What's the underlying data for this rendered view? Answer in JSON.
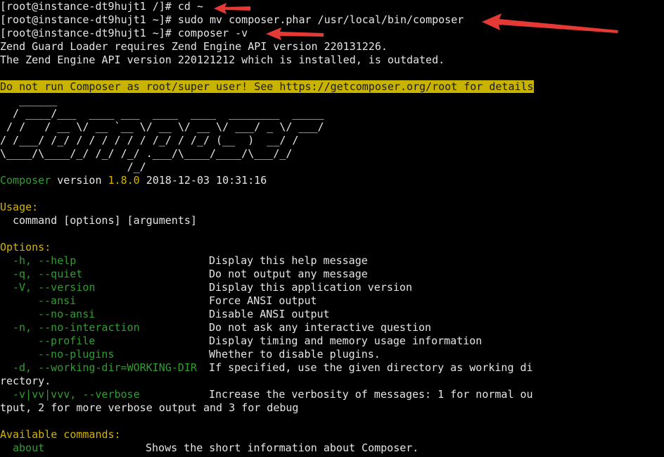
{
  "terminal": {
    "commands": [
      {
        "prompt": "[root@instance-dt9hujt1 /]# ",
        "command": "cd ~"
      },
      {
        "prompt": "[root@instance-dt9hujt1 ~]# ",
        "command": "sudo mv composer.phar /usr/local/bin/composer"
      },
      {
        "prompt": "[root@instance-dt9hujt1 ~]# ",
        "command": "composer -v"
      }
    ],
    "errors": [
      "Zend Guard Loader requires Zend Engine API version 220131226.",
      "The Zend Engine API version 220121212 which is installed, is outdated."
    ],
    "warning": "Do not run Composer as root/super user! See https://getcomposer.org/root for details",
    "logo": [
      "   ______",
      "  / ____/___  ____ ___  ____  ____  ________  _____",
      " / /   / __ \\/ __ `__ \\/ __ \\/ __ \\/ ___/ _ \\/ ___/",
      "/ /___/ /_/ / / / / / / /_/ / /_/ (__  )  __/ /",
      "\\____/\\____/_/ /_/ /_/ .___/\\____/____/\\___/_/",
      "                    /_/"
    ],
    "version": {
      "name": "Composer",
      "label": " version ",
      "number": "1.8.0",
      "date": " 2018-12-03 10:31:16"
    },
    "usage": {
      "heading": "Usage:",
      "text": "command [options] [arguments]"
    },
    "options": {
      "heading": "Options:",
      "items": [
        {
          "name": "-h, --help",
          "desc": "Display this help message",
          "long": false
        },
        {
          "name": "-q, --quiet",
          "desc": "Do not output any message",
          "long": false
        },
        {
          "name": "-V, --version",
          "desc": "Display this application version",
          "long": false
        },
        {
          "name": "--ansi",
          "desc": "Force ANSI output",
          "long": true
        },
        {
          "name": "--no-ansi",
          "desc": "Disable ANSI output",
          "long": true
        },
        {
          "name": "-n, --no-interaction",
          "desc": "Do not ask any interactive question",
          "long": false
        },
        {
          "name": "--profile",
          "desc": "Display timing and memory usage information",
          "long": true
        },
        {
          "name": "--no-plugins",
          "desc": "Whether to disable plugins.",
          "long": true
        },
        {
          "name": "-d, --working-dir=WORKING-DIR",
          "desc": "If specified, use the given directory as working di",
          "long": false,
          "wrap": "rectory."
        },
        {
          "name": "-v|vv|vvv, --verbose",
          "desc": "Increase the verbosity of messages: 1 for normal ou",
          "long": false,
          "wrap": "tput, 2 for more verbose output and 3 for debug"
        }
      ]
    },
    "available": {
      "heading": "Available commands:",
      "items": [
        {
          "name": "about",
          "desc": "Shows the short information about Composer."
        }
      ]
    },
    "colors": {
      "background": "#000000",
      "text": "#e5e5e5",
      "green": "#2f9e2f",
      "yellow": "#d6b400",
      "warning_bg": "#c8b400",
      "arrow": "#e53935"
    }
  }
}
